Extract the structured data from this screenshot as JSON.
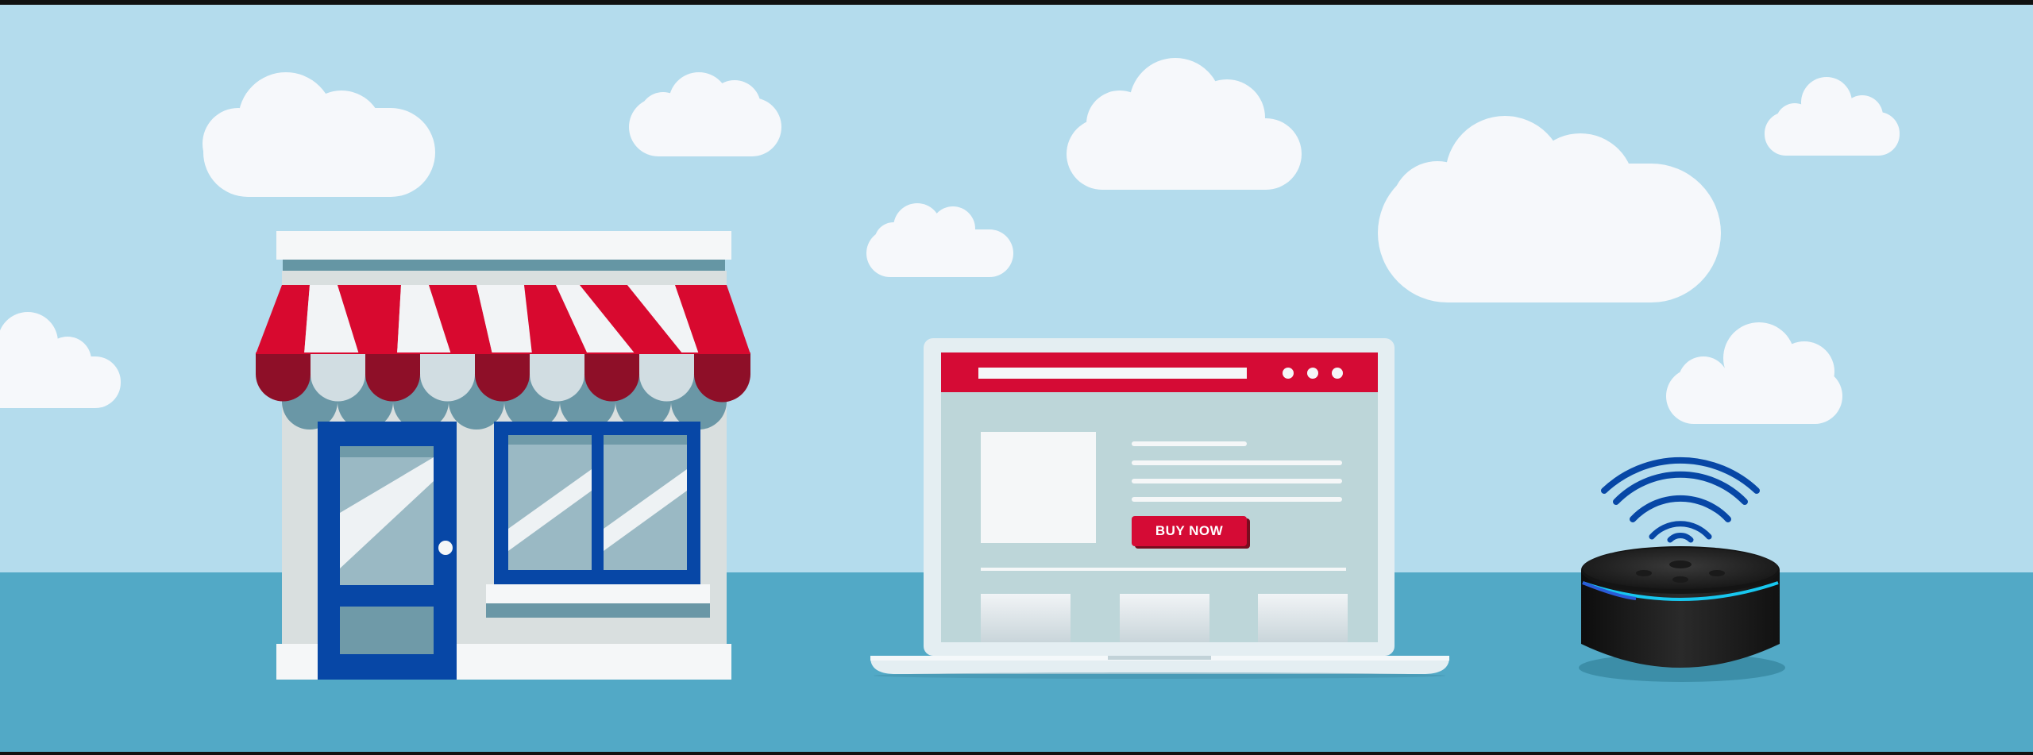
{
  "colors": {
    "sky": "#b4dced",
    "ground": "#52a9c6",
    "cloud": "#f6f8fb",
    "awning_red": "#d8092f",
    "awning_white": "#f2f4f6",
    "door_blue": "#0747a6",
    "browser_red": "#d50b35",
    "speaker_ring": "#18c7ef",
    "wifi_blue": "#0747a6"
  },
  "icons": [
    "cloud-icon",
    "storefront-icon",
    "laptop-icon",
    "smart-speaker-icon",
    "wifi-icon"
  ],
  "laptop": {
    "buy_button_label": "BUY NOW"
  }
}
